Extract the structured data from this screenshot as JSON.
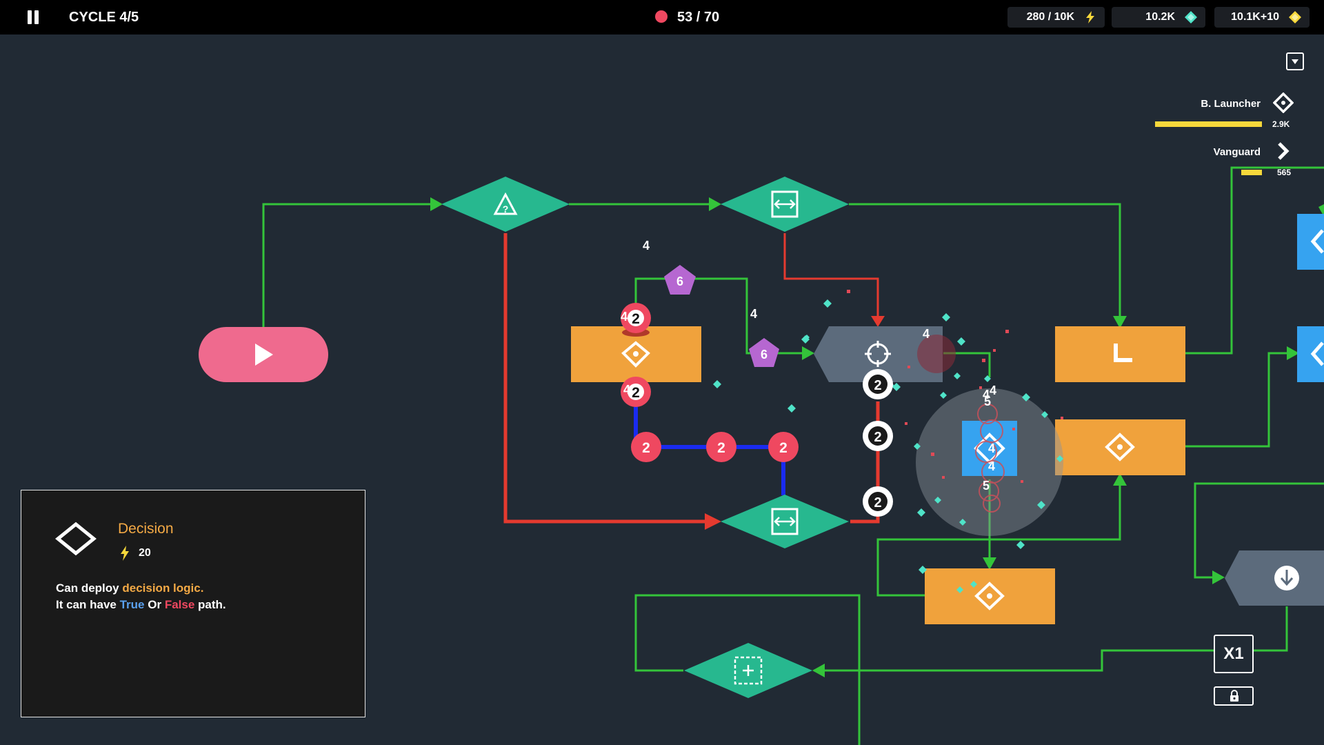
{
  "hud": {
    "cycle": "CYCLE 4/5",
    "lives": "53 / 70",
    "energy": "280 / 10K",
    "gems": "10.2K",
    "gold": "10.1K+10"
  },
  "units": [
    {
      "name": "B. Launcher",
      "value": "2.9K",
      "icon": "diamond-icon",
      "level": 1.0
    },
    {
      "name": "Vanguard",
      "value": "565",
      "icon": "chevron-right-icon",
      "level": 0.19
    }
  ],
  "info_panel": {
    "title": "Decision",
    "cost": "20",
    "line1_prefix": "Can deploy ",
    "line1_highlight": "decision logic.",
    "line2_prefix": "It can have ",
    "line2_true": "True",
    "line2_or": " Or ",
    "line2_false": "False",
    "line2_suffix": " path."
  },
  "speed_label": "X1",
  "board": {
    "enemy_counts": [
      "2",
      "2",
      "2",
      "2",
      "2",
      "2",
      "2",
      "2"
    ],
    "pentagon_counts": [
      "6",
      "6"
    ],
    "floating_numbers": [
      "4",
      "4",
      "4",
      "4",
      "4",
      "4",
      "4",
      "5",
      "4",
      "4",
      "5"
    ]
  },
  "colors": {
    "background": "#212a34",
    "node_teal": "#27b88f",
    "node_orange": "#f0a23c",
    "start_pink": "#ef6a8e",
    "wire_green": "#34c43a",
    "wire_red": "#e53a2f",
    "wire_blue": "#1a2bf0",
    "enemy_red": "#ef4860",
    "unit_blue": "#36a3f0",
    "gem_cyan": "#4fe3c8",
    "gold_yellow": "#f7d83b"
  }
}
